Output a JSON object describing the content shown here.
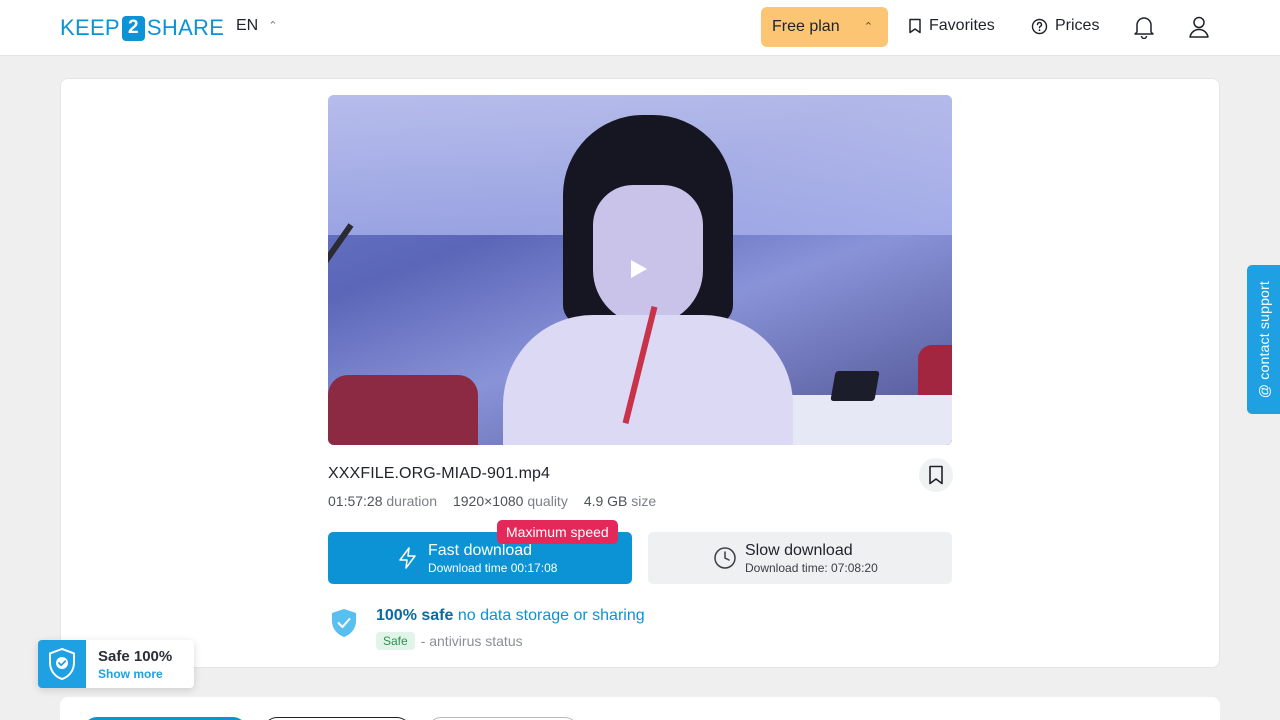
{
  "header": {
    "logo_left": "KEEP",
    "logo_mid": "2",
    "logo_right": "SHARE",
    "language": "EN",
    "plan_label": "Free plan",
    "favorites_label": "Favorites",
    "prices_label": "Prices",
    "icons": [
      "chevron-up-icon",
      "bookmark-icon",
      "question-circle-icon",
      "bell-icon",
      "user-icon"
    ]
  },
  "file": {
    "name": "XXXFILE.ORG-MIAD-901.mp4",
    "duration": "01:57:28",
    "duration_label": "duration",
    "quality": "1920×1080",
    "quality_label": "quality",
    "size": "4.9 GB",
    "size_label": "size"
  },
  "downloads": {
    "fast_title": "Fast download",
    "fast_time": "Download time 00:17:08",
    "speed_badge": "Maximum speed",
    "slow_title": "Slow download",
    "slow_time": "Download time: 07:08:20"
  },
  "safety": {
    "strong": "100% safe",
    "rest": "no data storage or sharing",
    "pill": "Safe",
    "status": "- antivirus status"
  },
  "support": {
    "label": "@ contact support"
  },
  "safe_widget": {
    "title": "Safe 100%",
    "link": "Show more"
  },
  "colors": {
    "brand": "#0b93d6",
    "plan": "#fbc574",
    "badge": "#e42859",
    "support": "#1ea0e3"
  }
}
